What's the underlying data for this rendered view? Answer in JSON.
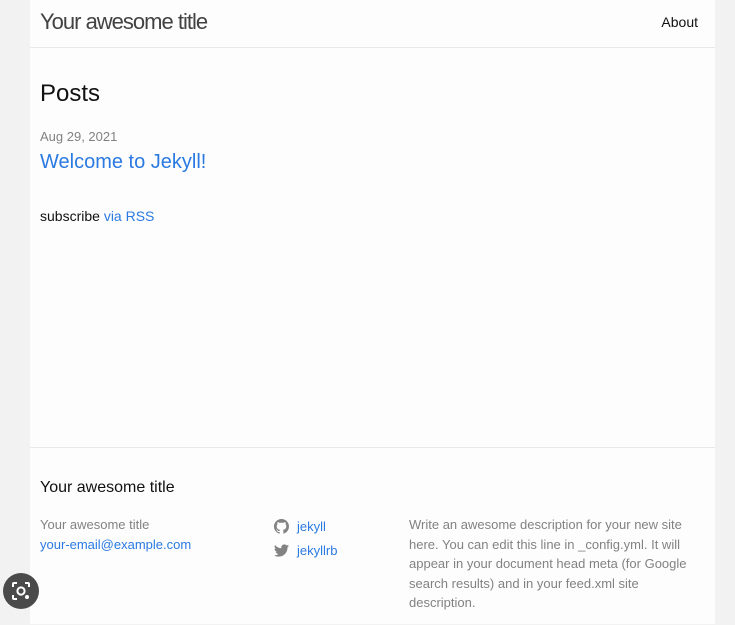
{
  "header": {
    "site_title": "Your awesome title",
    "nav_about": "About"
  },
  "main": {
    "heading": "Posts",
    "posts": [
      {
        "date": "Aug 29, 2021",
        "title": "Welcome to Jekyll!"
      }
    ],
    "rss_prefix": "subscribe",
    "rss_link": "via RSS"
  },
  "footer": {
    "heading": "Your awesome title",
    "col1_title": "Your awesome title",
    "email": "your-email@example.com",
    "social": [
      {
        "icon": "github-icon",
        "label": "jekyll"
      },
      {
        "icon": "twitter-icon",
        "label": "jekyllrb"
      }
    ],
    "description": "Write an awesome description for your new site here. You can edit this line in _config.yml. It will appear in your document head meta (for Google search results) and in your feed.xml site description."
  },
  "overlay": {
    "icon": "visual-search-icon"
  },
  "colors": {
    "link": "#2a7ae2",
    "meta": "#828282",
    "border": "#e8e8e8"
  }
}
